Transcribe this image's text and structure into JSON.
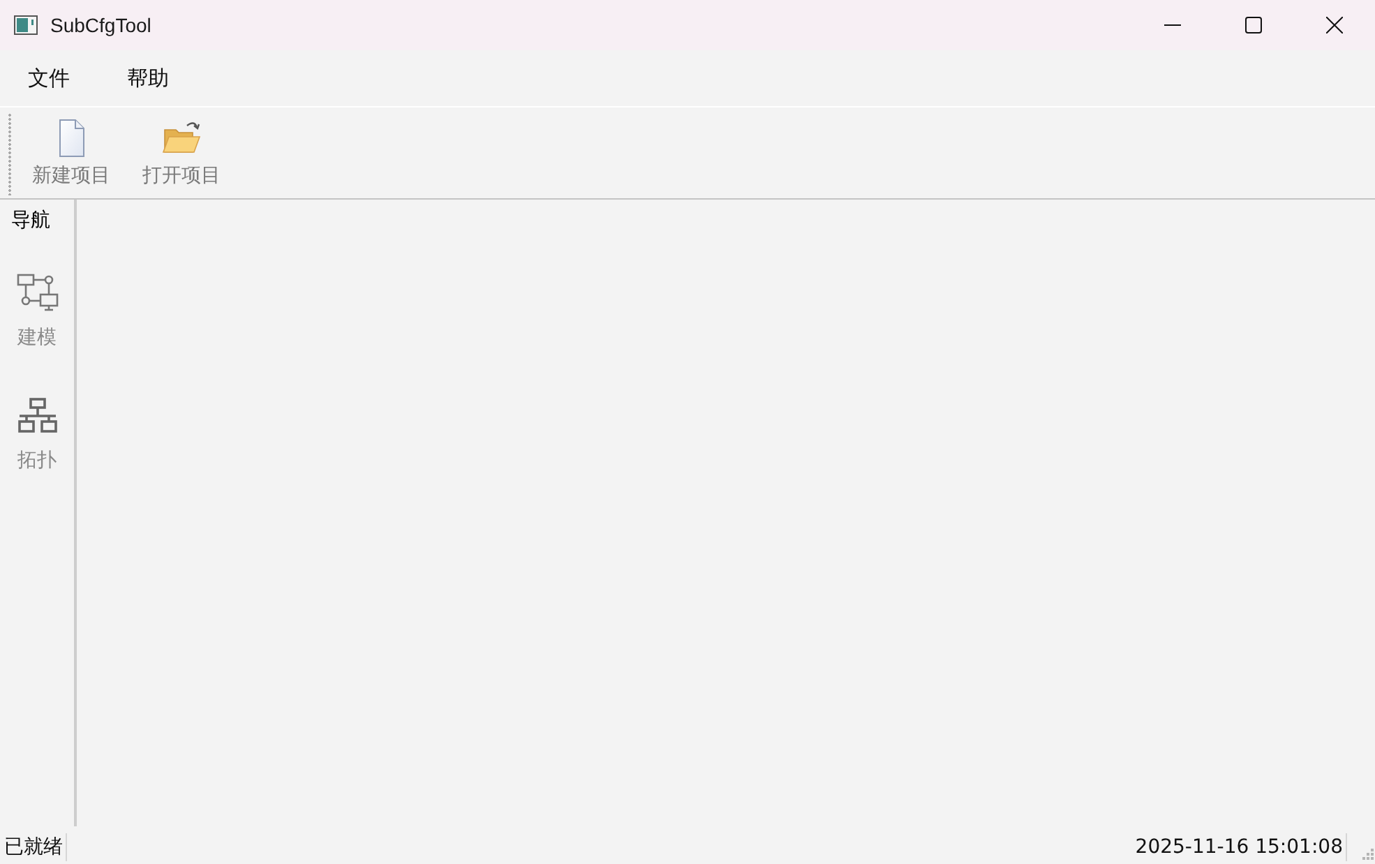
{
  "window": {
    "title": "SubCfgTool"
  },
  "menu_bar": {
    "items": [
      "文件",
      "帮助"
    ]
  },
  "toolbar": {
    "buttons": [
      {
        "kind": "new",
        "label": "新建项目"
      },
      {
        "kind": "open",
        "label": "打开项目"
      }
    ]
  },
  "nav_panel": {
    "title": "导航",
    "items": [
      {
        "kind": "modeling",
        "label": "建模"
      },
      {
        "kind": "topology",
        "label": "拓扑"
      }
    ]
  },
  "status_bar": {
    "message": "已就绪",
    "datetime": "2025-11-16 15:01:08"
  }
}
